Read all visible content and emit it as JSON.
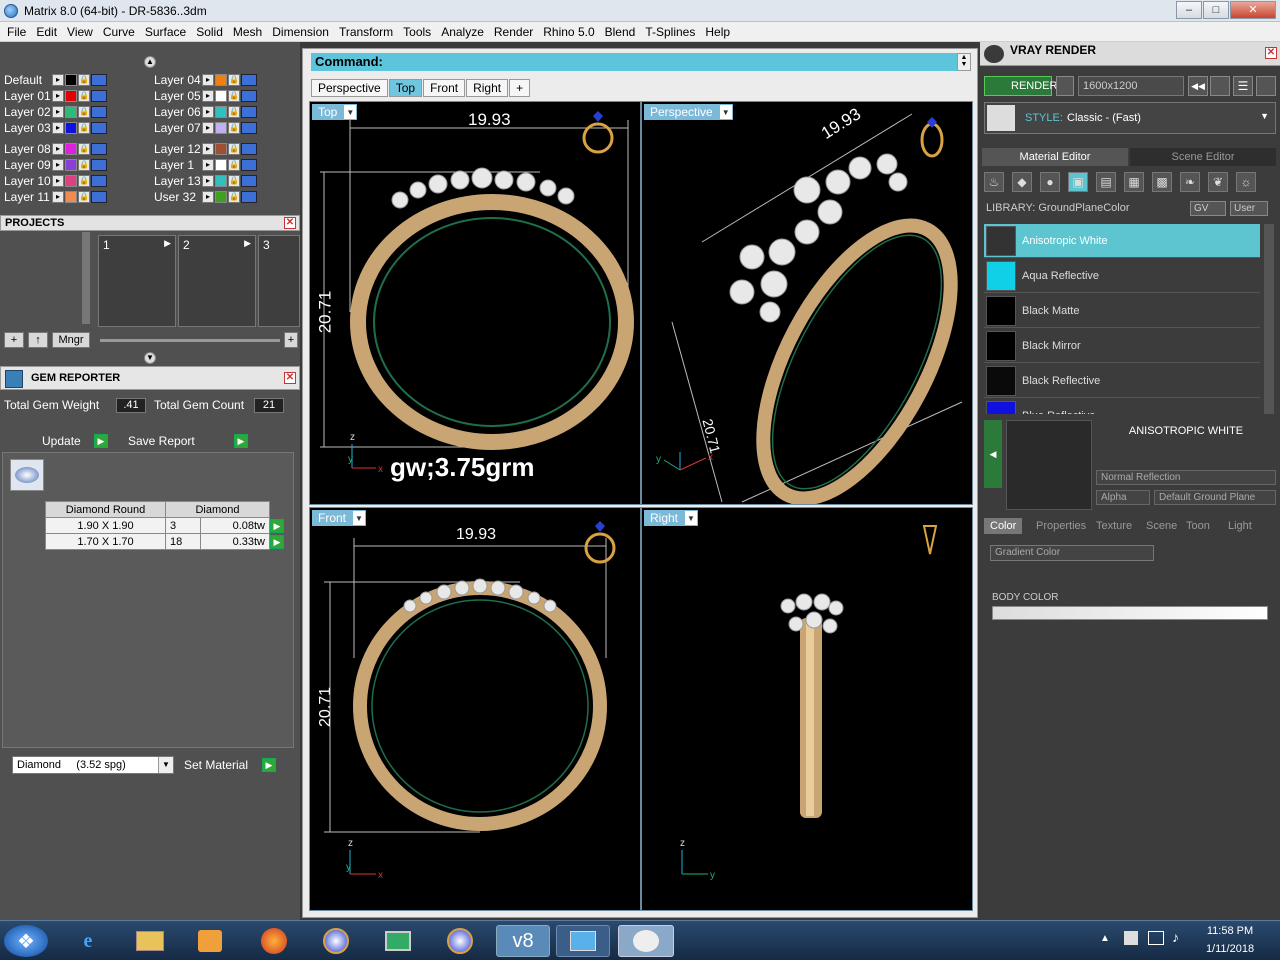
{
  "window": {
    "title": "Matrix 8.0 (64-bit) - DR-5836..3dm"
  },
  "menu": [
    "File",
    "Edit",
    "View",
    "Curve",
    "Surface",
    "Solid",
    "Mesh",
    "Dimension",
    "Transform",
    "Tools",
    "Analyze",
    "Render",
    "Rhino 5.0",
    "Blend",
    "T-Splines",
    "Help"
  ],
  "layers": {
    "left": [
      {
        "name": "Default",
        "color": "#000000"
      },
      {
        "name": "Layer 01",
        "color": "#e00000"
      },
      {
        "name": "Layer 02",
        "color": "#2dbb7a"
      },
      {
        "name": "Layer 03",
        "color": "#1010e0"
      },
      {
        "name": "Layer 08",
        "color": "#e020e0"
      },
      {
        "name": "Layer 09",
        "color": "#8a40d8"
      },
      {
        "name": "Layer 10",
        "color": "#e04080"
      },
      {
        "name": "Layer 11",
        "color": "#f08a50"
      }
    ],
    "right": [
      {
        "name": "Layer 04",
        "color": "#f08010"
      },
      {
        "name": "Layer 05",
        "color": "#ffffff"
      },
      {
        "name": "Layer 06",
        "color": "#30c0c0"
      },
      {
        "name": "Layer 07",
        "color": "#c0b0f0"
      },
      {
        "name": "Layer 12",
        "color": "#a05030"
      },
      {
        "name": "Layer 1",
        "color": "#ffffff"
      },
      {
        "name": "Layer 13",
        "color": "#30c0c0"
      },
      {
        "name": "User 32",
        "color": "#40a020"
      }
    ]
  },
  "projects": {
    "title": "PROJECTS",
    "cells": [
      "1",
      "2",
      "3"
    ],
    "mngr_label": "Mngr"
  },
  "gem_reporter": {
    "title": "GEM REPORTER",
    "total_weight_label": "Total Gem Weight",
    "total_weight": ".41",
    "total_count_label": "Total Gem Count",
    "total_count": "21",
    "update_label": "Update",
    "save_report_label": "Save Report",
    "table_headers": [
      "Diamond Round",
      "Diamond"
    ],
    "rows": [
      {
        "size": "1.90 X 1.90",
        "qty": "3",
        "tw": "0.08tw"
      },
      {
        "size": "1.70 X 1.70",
        "qty": "18",
        "tw": "0.33tw"
      }
    ],
    "material_select": "Diamond     (3.52 spg)",
    "set_material_label": "Set Material"
  },
  "command": {
    "label": "Command:"
  },
  "view_tabs": [
    "Perspective",
    "Top",
    "Front",
    "Right",
    "+"
  ],
  "active_tab": "Top",
  "viewports": {
    "top": {
      "label": "Top",
      "width_dim": "19.93",
      "height_dim": "20.71",
      "annotation": "gw;3.75grm"
    },
    "perspective": {
      "label": "Perspective",
      "dim1": "19.93",
      "dim2": "20.71"
    },
    "front": {
      "label": "Front",
      "width_dim": "19.93",
      "height_dim": "20.71"
    },
    "right": {
      "label": "Right"
    }
  },
  "vray": {
    "title": "VRAY RENDER",
    "render_label": "RENDER",
    "resolution": "1600x1200",
    "style_label": "STYLE:",
    "style_value": "Classic - (Fast)",
    "tabs": [
      "Material Editor",
      "Scene Editor"
    ],
    "library_label": "LIBRARY: GroundPlaneColor",
    "gv_label": "GV",
    "user_label": "User",
    "materials": [
      {
        "name": "Anisotropic White",
        "color": "#333333"
      },
      {
        "name": "Aqua Reflective",
        "color": "#10d0e8"
      },
      {
        "name": "Black Matte",
        "color": "#000000"
      },
      {
        "name": "Black Mirror",
        "color": "#000000"
      },
      {
        "name": "Black Reflective",
        "color": "#0a0a0a"
      },
      {
        "name": "Blue Reflective",
        "color": "#1010e0"
      }
    ],
    "selected_material": "ANISOTROPIC WHITE",
    "reflection_select": "Normal Reflection",
    "alpha_label": "Alpha",
    "ground_plane_select": "Default Ground Plane",
    "prop_tabs": [
      "Color",
      "Properties",
      "Texture",
      "Scene",
      "Toon",
      "Light"
    ],
    "gradient_select": "Gradient Color",
    "body_color_label": "BODY COLOR"
  },
  "taskbar": {
    "time": "11:58 PM",
    "date": "1/11/2018"
  }
}
